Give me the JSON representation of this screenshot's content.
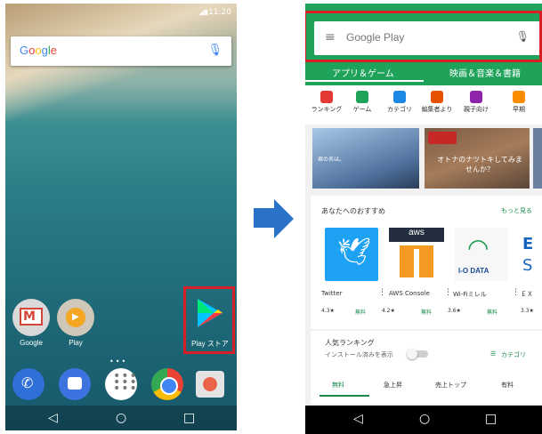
{
  "left_phone": {
    "time": "11:20",
    "search_brand": "Google",
    "apps": [
      {
        "label": "Google",
        "icon": "gmail-folder-icon"
      },
      {
        "label": "Play",
        "icon": "play-folder-icon"
      },
      {
        "label": "Play ストア",
        "icon": "play-store-icon"
      }
    ],
    "dock": [
      "phone-icon",
      "messages-icon",
      "app-drawer-icon",
      "chrome-icon",
      "camera-icon"
    ]
  },
  "arrow": {
    "color": "#2a72c8"
  },
  "right_phone": {
    "search_placeholder": "Google Play",
    "tabs": [
      "アプリ＆ゲーム",
      "映画＆音楽＆書籍"
    ],
    "categories": [
      "ランキング",
      "ゲーム",
      "カテゴリ",
      "編集者より",
      "親子向け",
      "早期"
    ],
    "banner_text": "オトナのナツトキしてみませんか？",
    "banner_small": "君の名は。",
    "recommend": {
      "title": "あなたへのおすすめ",
      "more": "もっと見る",
      "apps": [
        {
          "name": "Twitter",
          "price": "無料",
          "rating": "4.3★"
        },
        {
          "name": "AWS Console",
          "price": "無料",
          "rating": "4.2★"
        },
        {
          "name": "Wi-Fiミレル",
          "price": "無料",
          "rating": "3.6★"
        },
        {
          "name": "ＥＸ",
          "price": "無料",
          "rating": "3.3★"
        }
      ],
      "aws_label": "aws",
      "iodata_label": "I-O DATA"
    },
    "ranking": {
      "title": "人気ランキング",
      "subtitle": "インストール済みを表示",
      "category_link": "カテゴリ",
      "tabs": [
        "無料",
        "急上昇",
        "売上トップ",
        "有料"
      ]
    }
  },
  "colors": {
    "play_green": "#1fa35b",
    "highlight_red": "#d81f26"
  }
}
